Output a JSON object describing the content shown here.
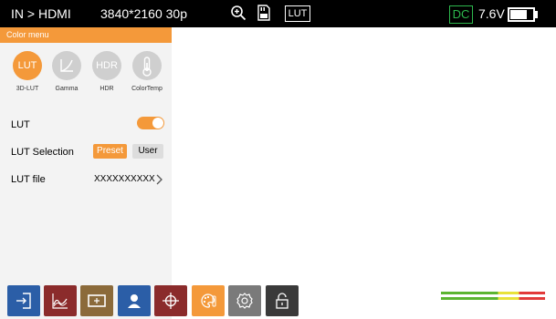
{
  "topbar": {
    "input": "IN > HDMI",
    "resolution": "3840*2160 30p",
    "lut_badge": "LUT",
    "dc": "DC",
    "voltage": "7.6V",
    "battery_level": 0.75,
    "icons": [
      "zoom-in-icon",
      "sd-card-icon",
      "battery-icon"
    ]
  },
  "menu": {
    "title": "Color menu",
    "categories": [
      {
        "label": "3D-LUT",
        "icon_text": "LUT",
        "active": true
      },
      {
        "label": "Gamma",
        "icon": "gamma-curve-icon",
        "active": false
      },
      {
        "label": "HDR",
        "icon_text": "HDR",
        "active": false
      },
      {
        "label": "ColorTemp",
        "icon": "thermometer-icon",
        "active": false
      }
    ],
    "lut": {
      "label": "LUT",
      "enabled": true
    },
    "lut_selection": {
      "label": "LUT Selection",
      "options": [
        "Preset",
        "User"
      ],
      "selected": "Preset"
    },
    "lut_file": {
      "label": "LUT file",
      "value": "XXXXXXXXXX"
    }
  },
  "bottom_buttons": [
    {
      "name": "input-icon",
      "color": "#2b5ea7"
    },
    {
      "name": "waveform-icon",
      "color": "#8b2b2b"
    },
    {
      "name": "marker-icon",
      "color": "#8b6a3a"
    },
    {
      "name": "peaking-person-icon",
      "color": "#2b5ea7"
    },
    {
      "name": "crosshair-icon",
      "color": "#8b2b2b"
    },
    {
      "name": "color-palette-icon",
      "color": "#f4993a"
    },
    {
      "name": "settings-gear-icon",
      "color": "#7a7a7a"
    },
    {
      "name": "lock-icon",
      "color": "#3a3a3a"
    }
  ],
  "colors": {
    "accent": "#f4993a",
    "topbar_bg": "#000000",
    "dc_green": "#2db84d",
    "meter_green": "#5cb531",
    "meter_yellow": "#e8e23a",
    "meter_red": "#e23a3a"
  }
}
